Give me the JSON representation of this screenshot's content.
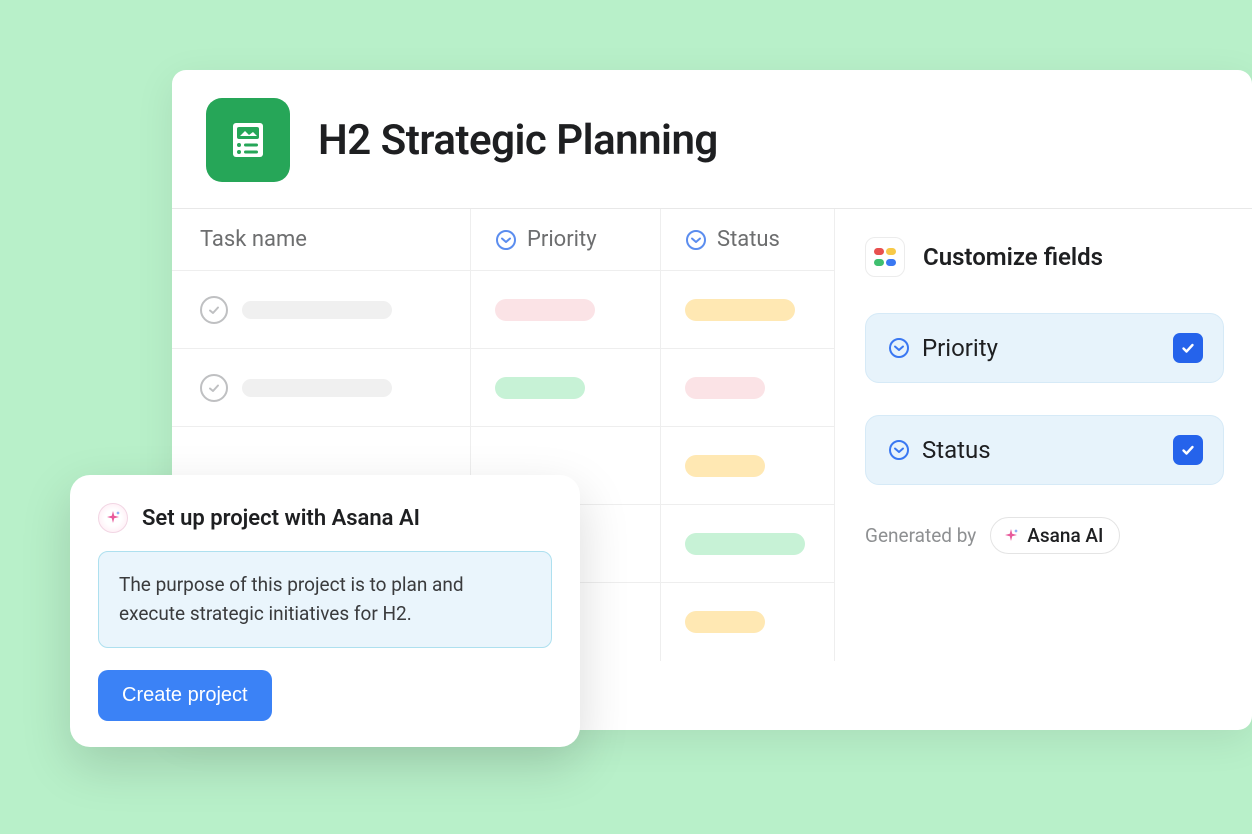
{
  "project": {
    "title": "H2 Strategic Planning"
  },
  "table": {
    "columns": {
      "task_name": "Task name",
      "priority": "Priority",
      "status": "Status"
    },
    "rows": [
      {
        "priority_color": "pink",
        "status_color": "yellow"
      },
      {
        "priority_color": "green",
        "status_color": "pink"
      },
      {
        "priority_color": "",
        "status_color": "yellow"
      },
      {
        "priority_color": "yellow",
        "status_color": "green-wide"
      },
      {
        "priority_color": "",
        "status_color": "yellow"
      }
    ]
  },
  "side_panel": {
    "title": "Customize fields",
    "fields": [
      {
        "label": "Priority",
        "checked": true
      },
      {
        "label": "Status",
        "checked": true
      }
    ],
    "generated_label": "Generated by",
    "generated_chip": "Asana AI"
  },
  "ai_popup": {
    "title": "Set up project with Asana AI",
    "description": "The purpose of this project is to plan and execute strategic initiatives for H2.",
    "button": "Create project"
  }
}
